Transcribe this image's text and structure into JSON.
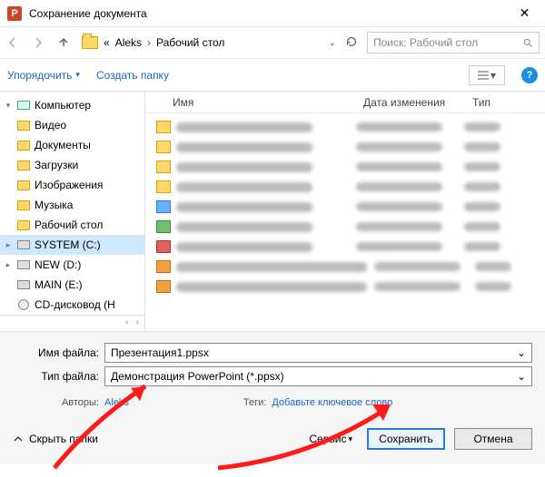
{
  "titlebar": {
    "title": "Сохранение документа"
  },
  "path": {
    "prefix": "«",
    "seg1": "Aleks",
    "seg2": "Рабочий стол"
  },
  "search": {
    "placeholder": "Поиск: Рабочий стол"
  },
  "toolbar": {
    "organize": "Упорядочить",
    "new_folder": "Создать папку"
  },
  "columns": {
    "name": "Имя",
    "date": "Дата изменения",
    "type": "Тип"
  },
  "sidebar": {
    "computer": "Компьютер",
    "items": [
      "Видео",
      "Документы",
      "Загрузки",
      "Изображения",
      "Музыка",
      "Рабочий стол",
      "SYSTEM (C:)",
      "NEW (D:)",
      "MAIN (E:)",
      "CD-дисковод (H"
    ]
  },
  "fields": {
    "filename_label": "Имя файла:",
    "filename_value": "Презентация1.ppsx",
    "filetype_label": "Тип файла:",
    "filetype_value": "Демонстрация PowerPoint (*.ppsx)",
    "authors_label": "Авторы:",
    "authors_value": "Aleks",
    "tags_label": "Теги:",
    "tags_placeholder": "Добавьте ключевое слово"
  },
  "actions": {
    "hide_folders": "Скрыть папки",
    "service": "Сервис",
    "save": "Сохранить",
    "cancel": "Отмена"
  }
}
